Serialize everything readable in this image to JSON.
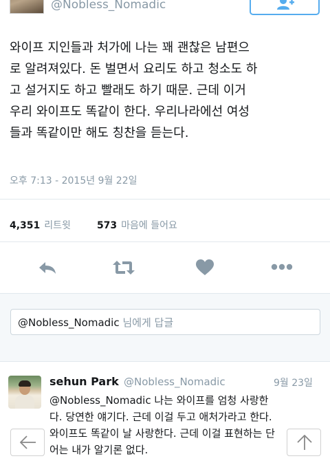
{
  "top": {
    "handle": "@Nobless_Nomadic"
  },
  "tweet": {
    "lines": [
      "와이프 지인들과 처가에 나는 꽤 괜찮은 남편으",
      "로 알려져있다. 돈 벌면서 요리도 하고 청소도 하",
      "고 설거지도 하고 빨래도 하기 때문. 근데 이거",
      "우리 와이프도 똑같이 한다. 우리나라에선 여성",
      "들과 똑같이만 해도 칭찬을 듣는다."
    ],
    "timestamp": "오후 7:13 - 2015년 9월 22일",
    "retweet_count": "4,351",
    "retweet_label": "리트윗",
    "like_count": "573",
    "like_label": "마음에 들어요"
  },
  "actions": {
    "icons": [
      "reply-icon",
      "retweet-icon",
      "heart-icon",
      "more-icon"
    ],
    "accent": "#8899a6"
  },
  "reply_box": {
    "mention": "@Nobless_Nomadic",
    "suffix": "님에게 답글"
  },
  "reply": {
    "name": "sehun Park",
    "handle": "@Nobless_Nomadic",
    "date": "9월 23일",
    "line1_mention": "@Nobless_Nomadic",
    "line1_rest": " 나는 와이프를 엄청 사랑한",
    "lines": [
      "다. 당연한 얘기다. 근데 이걸 두고 애처가라고 한다.",
      "와이프도 똑같이 날 사랑한다. 근데 이걸 표현하는 단",
      "어는 내가 알기론 없다."
    ]
  },
  "nav": {
    "back_icon": "arrow-left-icon",
    "top_icon": "arrow-up-icon"
  },
  "colors": {
    "brand": "#55acee",
    "muted": "#8899a6",
    "text": "#14171a",
    "divider": "#e1e8ed"
  }
}
